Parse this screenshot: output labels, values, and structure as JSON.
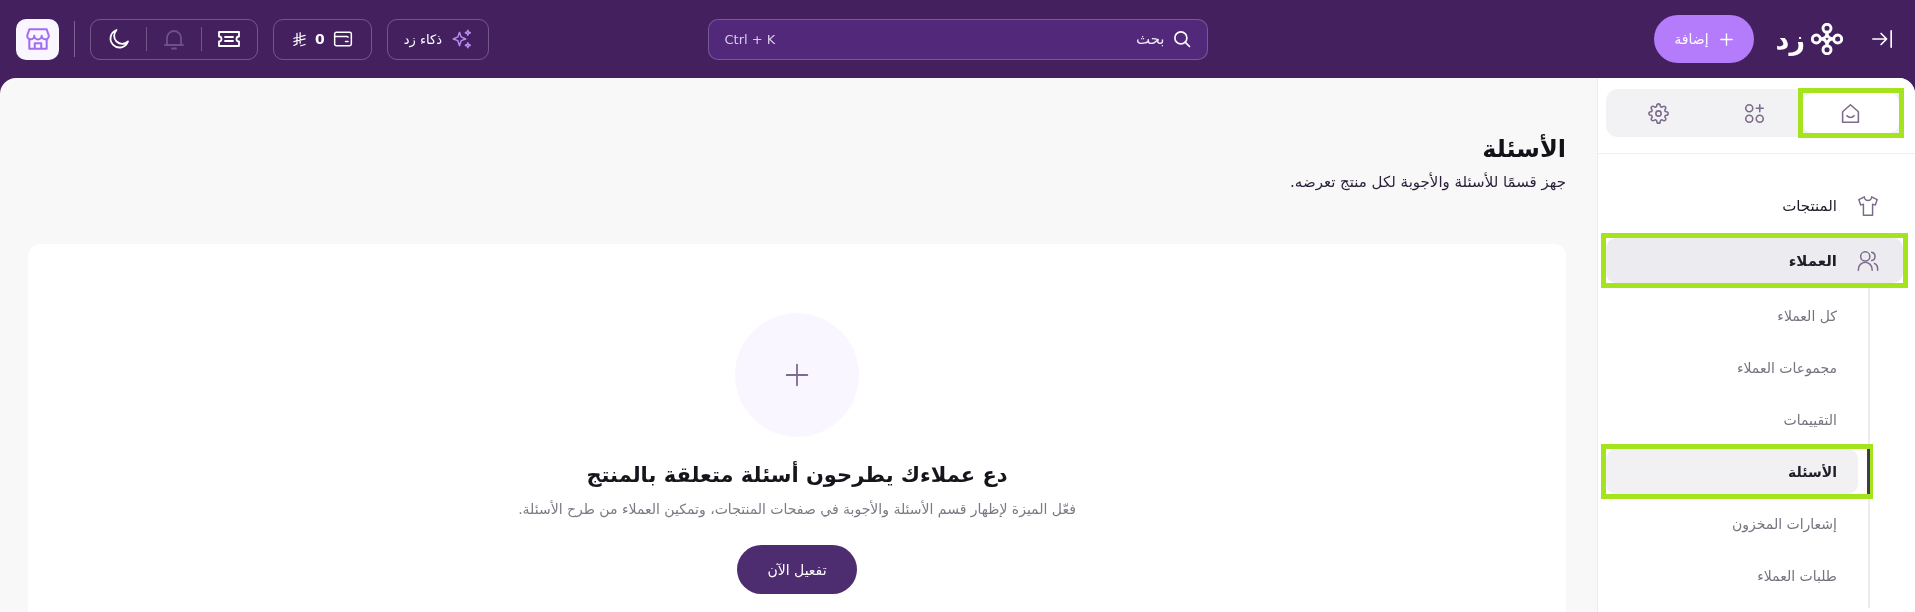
{
  "top_bar": {
    "logo": "زد",
    "add_button": "إضافة",
    "search": {
      "placeholder": "بحث",
      "shortcut": "Ctrl + K"
    },
    "ai_button": "ذكاء زد",
    "wallet": {
      "balance": "0"
    },
    "tools": [
      {
        "kind": "ticket",
        "disabled": false
      },
      {
        "kind": "bell",
        "disabled": true
      },
      {
        "kind": "moon",
        "disabled": false
      }
    ]
  },
  "sidebar": {
    "tabs": [
      {
        "kind": "home",
        "selected": true,
        "highlighted": true
      },
      {
        "kind": "apps",
        "selected": false,
        "highlighted": false
      },
      {
        "kind": "settings",
        "selected": false,
        "highlighted": false
      }
    ],
    "items": [
      {
        "kind": "shirt",
        "label": "المنتجات",
        "selected": false,
        "highlighted": false
      },
      {
        "kind": "users",
        "label": "العملاء",
        "selected": true,
        "highlighted": true,
        "children": [
          {
            "label": "كل العملاء",
            "selected": false,
            "highlighted": false
          },
          {
            "label": "مجموعات العملاء",
            "selected": false,
            "highlighted": false
          },
          {
            "label": "التقييمات",
            "selected": false,
            "highlighted": false
          },
          {
            "label": "الأسئلة",
            "selected": true,
            "highlighted": true
          },
          {
            "label": "إشعارات المخزون",
            "selected": false,
            "highlighted": false
          },
          {
            "label": "طلبات العملاء",
            "selected": false,
            "highlighted": false
          }
        ]
      }
    ]
  },
  "main": {
    "title": "الأسئلة",
    "subtitle": "جهز قسمًا للأسئلة والأجوبة لكل منتج تعرضه.",
    "empty_state": {
      "heading": "دع عملاءك يطرحون أسئلة متعلقة بالمنتج",
      "description": "فعّل الميزة لإظهار قسم الأسئلة والأجوبة في صفحات المنتجات، وتمكين العملاء من طرح الأسئلة.",
      "button": "تفعيل الآن"
    }
  }
}
